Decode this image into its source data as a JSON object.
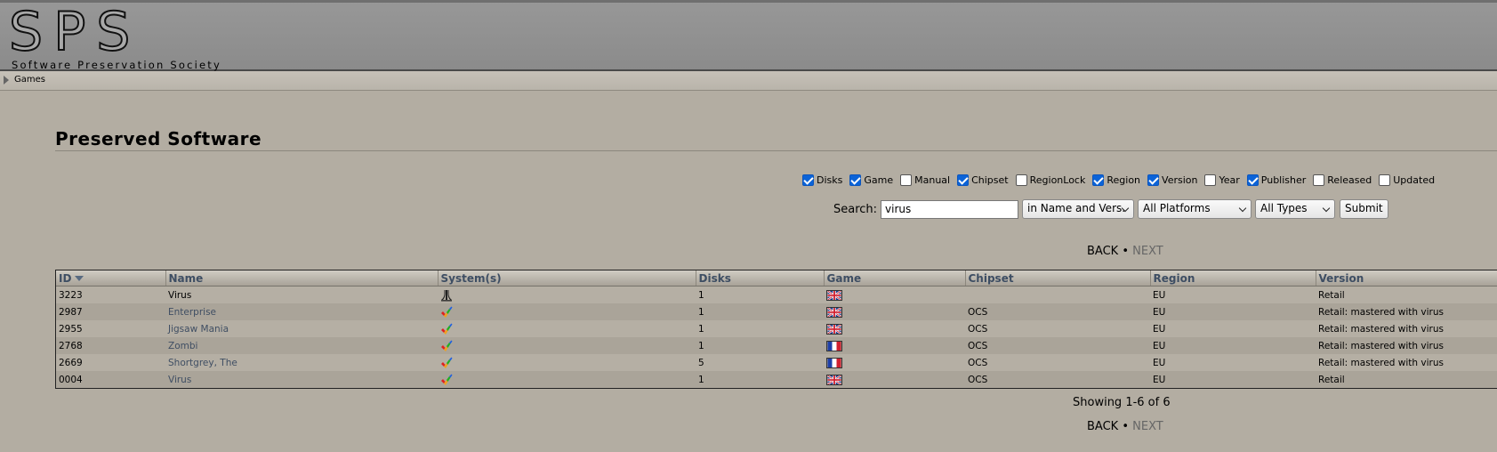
{
  "header": {
    "logo_letters": "SPS",
    "logo_subtitle": "Software Preservation Society"
  },
  "breadcrumb": {
    "items": [
      "Games"
    ]
  },
  "page": {
    "title": "Preserved Software"
  },
  "filters": [
    {
      "label": "Disks",
      "checked": true
    },
    {
      "label": "Game",
      "checked": true
    },
    {
      "label": "Manual",
      "checked": false
    },
    {
      "label": "Chipset",
      "checked": true
    },
    {
      "label": "RegionLock",
      "checked": false
    },
    {
      "label": "Region",
      "checked": true
    },
    {
      "label": "Version",
      "checked": true
    },
    {
      "label": "Year",
      "checked": false
    },
    {
      "label": "Publisher",
      "checked": true
    },
    {
      "label": "Released",
      "checked": false
    },
    {
      "label": "Updated",
      "checked": false
    }
  ],
  "search": {
    "label": "Search:",
    "value": "virus",
    "scope": "in Name and Vers.",
    "platform": "All Platforms",
    "type": "All Types",
    "submit_label": "Submit"
  },
  "pager": {
    "back": "BACK",
    "separator": "•",
    "next": "NEXT"
  },
  "table": {
    "columns": [
      "ID",
      "Name",
      "System(s)",
      "Disks",
      "Game",
      "Chipset",
      "Region",
      "Version"
    ],
    "rows": [
      {
        "id": "3223",
        "name": "Virus",
        "system": "atari-st-icon",
        "disks": "1",
        "flag": "uk",
        "chipset": "",
        "region": "EU",
        "version": "Retail",
        "linked": false
      },
      {
        "id": "2987",
        "name": "Enterprise",
        "system": "amiga-check-icon",
        "disks": "1",
        "flag": "uk",
        "chipset": "OCS",
        "region": "EU",
        "version": "Retail: mastered with virus",
        "linked": true
      },
      {
        "id": "2955",
        "name": "Jigsaw Mania",
        "system": "amiga-check-icon",
        "disks": "1",
        "flag": "uk",
        "chipset": "OCS",
        "region": "EU",
        "version": "Retail: mastered with virus",
        "linked": true
      },
      {
        "id": "2768",
        "name": "Zombi",
        "system": "amiga-check-icon",
        "disks": "1",
        "flag": "fr",
        "chipset": "OCS",
        "region": "EU",
        "version": "Retail: mastered with virus",
        "linked": true
      },
      {
        "id": "2669",
        "name": "Shortgrey, The",
        "system": "amiga-check-icon",
        "disks": "5",
        "flag": "fr",
        "chipset": "OCS",
        "region": "EU",
        "version": "Retail: mastered with virus",
        "linked": true
      },
      {
        "id": "0004",
        "name": "Virus",
        "system": "amiga-check-icon",
        "disks": "1",
        "flag": "uk",
        "chipset": "OCS",
        "region": "EU",
        "version": "Retail",
        "linked": true
      }
    ]
  },
  "footer": {
    "showing": "Showing 1-6 of 6"
  },
  "colors": {
    "background": "#b3ada2",
    "link": "#3f4e63",
    "header_text": "#3e4e63"
  }
}
